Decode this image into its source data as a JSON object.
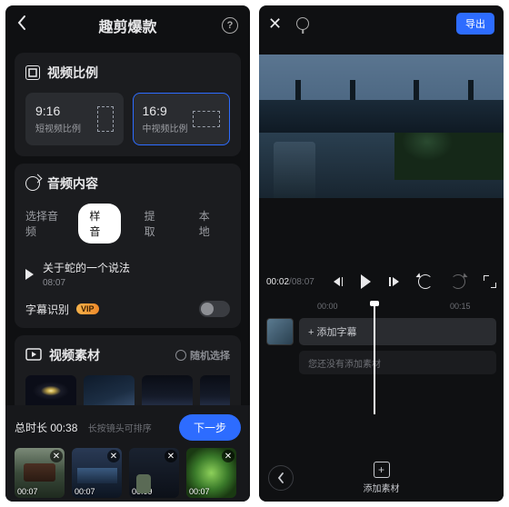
{
  "left": {
    "header": {
      "title": "趣剪爆款"
    },
    "ratio": {
      "section_title": "视频比例",
      "items": [
        {
          "ratio": "9:16",
          "label": "短视频比例",
          "selected": false
        },
        {
          "ratio": "16:9",
          "label": "中视频比例",
          "selected": true
        }
      ]
    },
    "audio": {
      "section_title": "音频内容",
      "choose_label": "选择音频",
      "tabs": [
        {
          "label": "样音",
          "active": true
        },
        {
          "label": "提取",
          "active": false
        },
        {
          "label": "本地",
          "active": false
        }
      ],
      "track": {
        "name": "关于蛇的一个说法",
        "duration": "08:07"
      },
      "subtitle_recog_label": "字幕识别",
      "vip_badge": "VIP",
      "subtitle_switch_on": false
    },
    "materials": {
      "section_title": "视频素材",
      "random_label": "随机选择"
    },
    "tray": {
      "total_label": "总时长",
      "total_value": "00:38",
      "hint": "长按镜头可排序",
      "next_label": "下一步",
      "clips": [
        {
          "duration": "00:07"
        },
        {
          "duration": "00:07"
        },
        {
          "duration": "00:09"
        },
        {
          "duration": "00:07"
        }
      ]
    }
  },
  "right": {
    "export_label": "导出",
    "time": {
      "current": "00:02",
      "total": "08:07"
    },
    "ruler": {
      "marks": [
        "00:00",
        "00:15"
      ]
    },
    "tracks": {
      "primary_label": "+ 添加字幕",
      "secondary_label": "您还没有添加素材"
    },
    "bottom": {
      "add_label": "添加素材"
    }
  }
}
